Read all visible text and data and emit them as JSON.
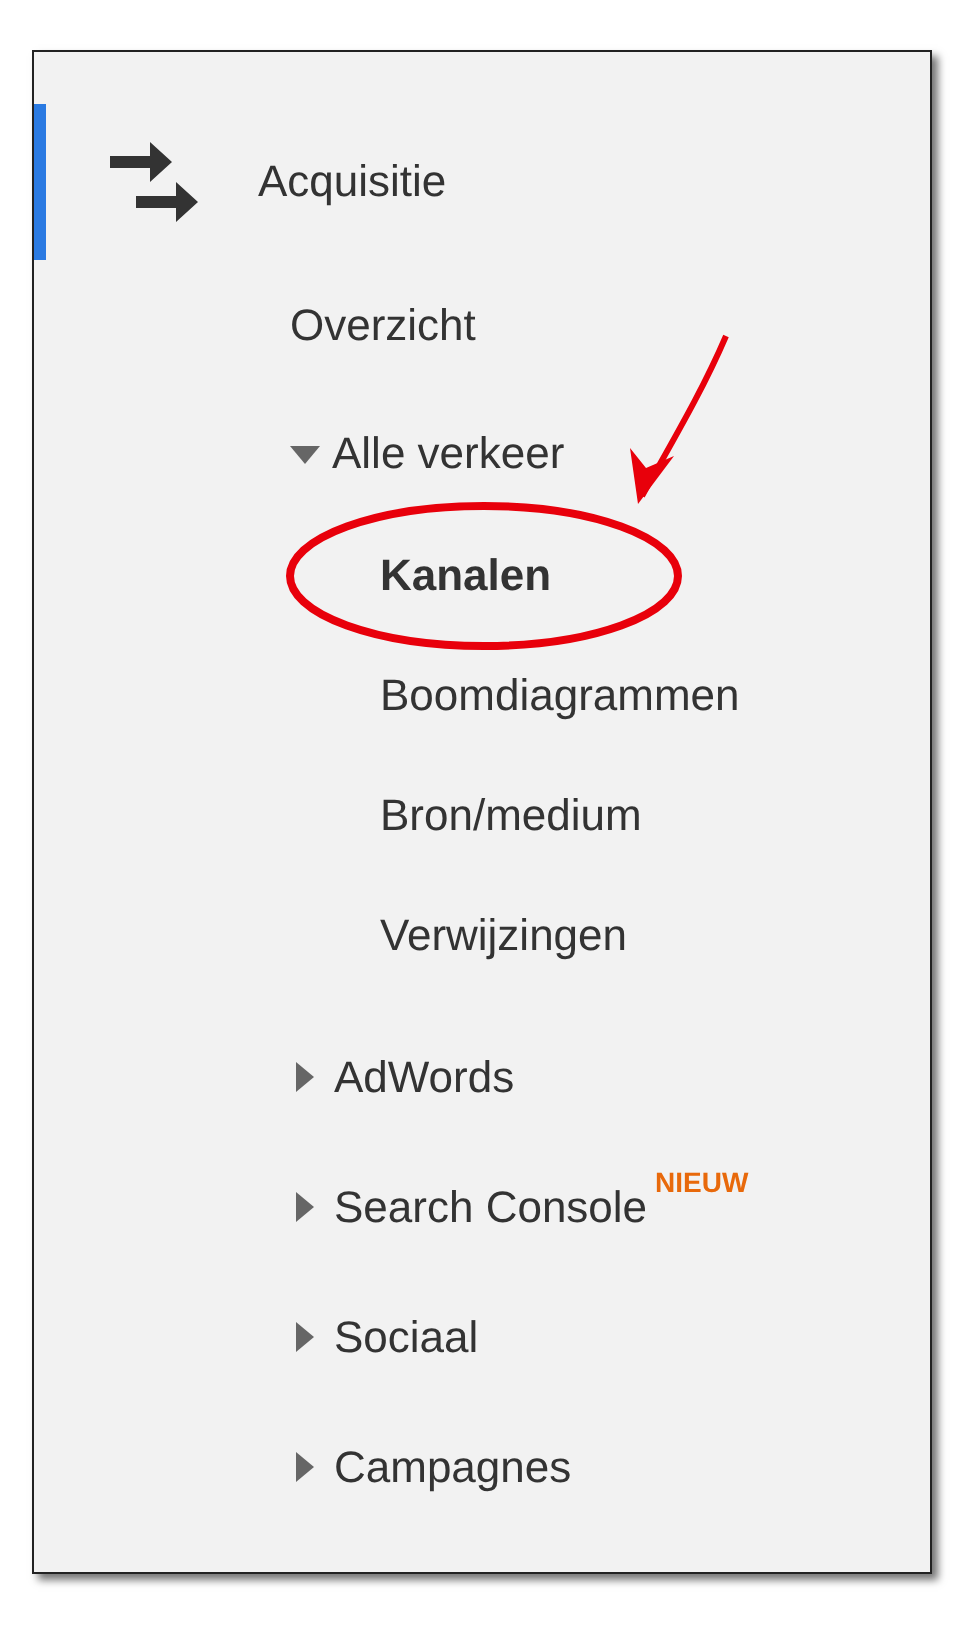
{
  "section": {
    "title": "Acquisitie",
    "selected": true
  },
  "items": [
    {
      "kind": "link",
      "label": "Overzicht"
    },
    {
      "kind": "group",
      "label": "Alle verkeer",
      "expanded": true,
      "children": [
        {
          "label": "Kanalen",
          "selected": true,
          "annotated": true
        },
        {
          "label": "Boomdiagrammen",
          "selected": false,
          "annotated": false
        },
        {
          "label": "Bron/medium",
          "selected": false,
          "annotated": false
        },
        {
          "label": "Verwijzingen",
          "selected": false,
          "annotated": false
        }
      ]
    },
    {
      "kind": "group",
      "label": "AdWords",
      "expanded": false
    },
    {
      "kind": "group",
      "label": "Search Console",
      "expanded": false,
      "badge": "NIEUW"
    },
    {
      "kind": "group",
      "label": "Sociaal",
      "expanded": false
    },
    {
      "kind": "group",
      "label": "Campagnes",
      "expanded": false
    }
  ]
}
